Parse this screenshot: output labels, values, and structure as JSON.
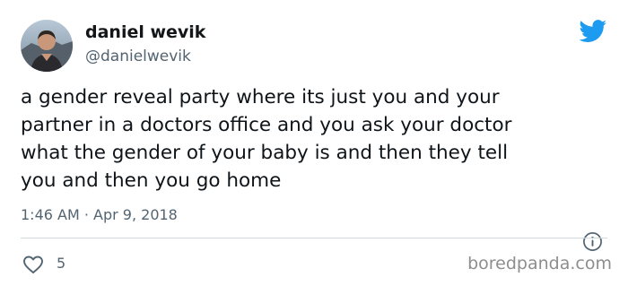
{
  "author": {
    "name": "daniel wevik",
    "handle": "@danielwevik"
  },
  "tweet": {
    "lines": [
      "a gender reveal party where its just you and your",
      "partner in a doctors office and you ask your doctor",
      "what the gender of your baby is and then they tell",
      "you and then you go home"
    ],
    "timestamp": "1:46 AM · Apr 9, 2018"
  },
  "actions": {
    "like_count": "5"
  },
  "watermark": "boredpanda.com",
  "colors": {
    "twitter_blue": "#1d9bf0",
    "secondary_text": "#536471",
    "divider": "#cfd9de"
  },
  "icons": {
    "logo": "twitter-bird-icon",
    "info": "info-icon",
    "like": "heart-icon"
  }
}
